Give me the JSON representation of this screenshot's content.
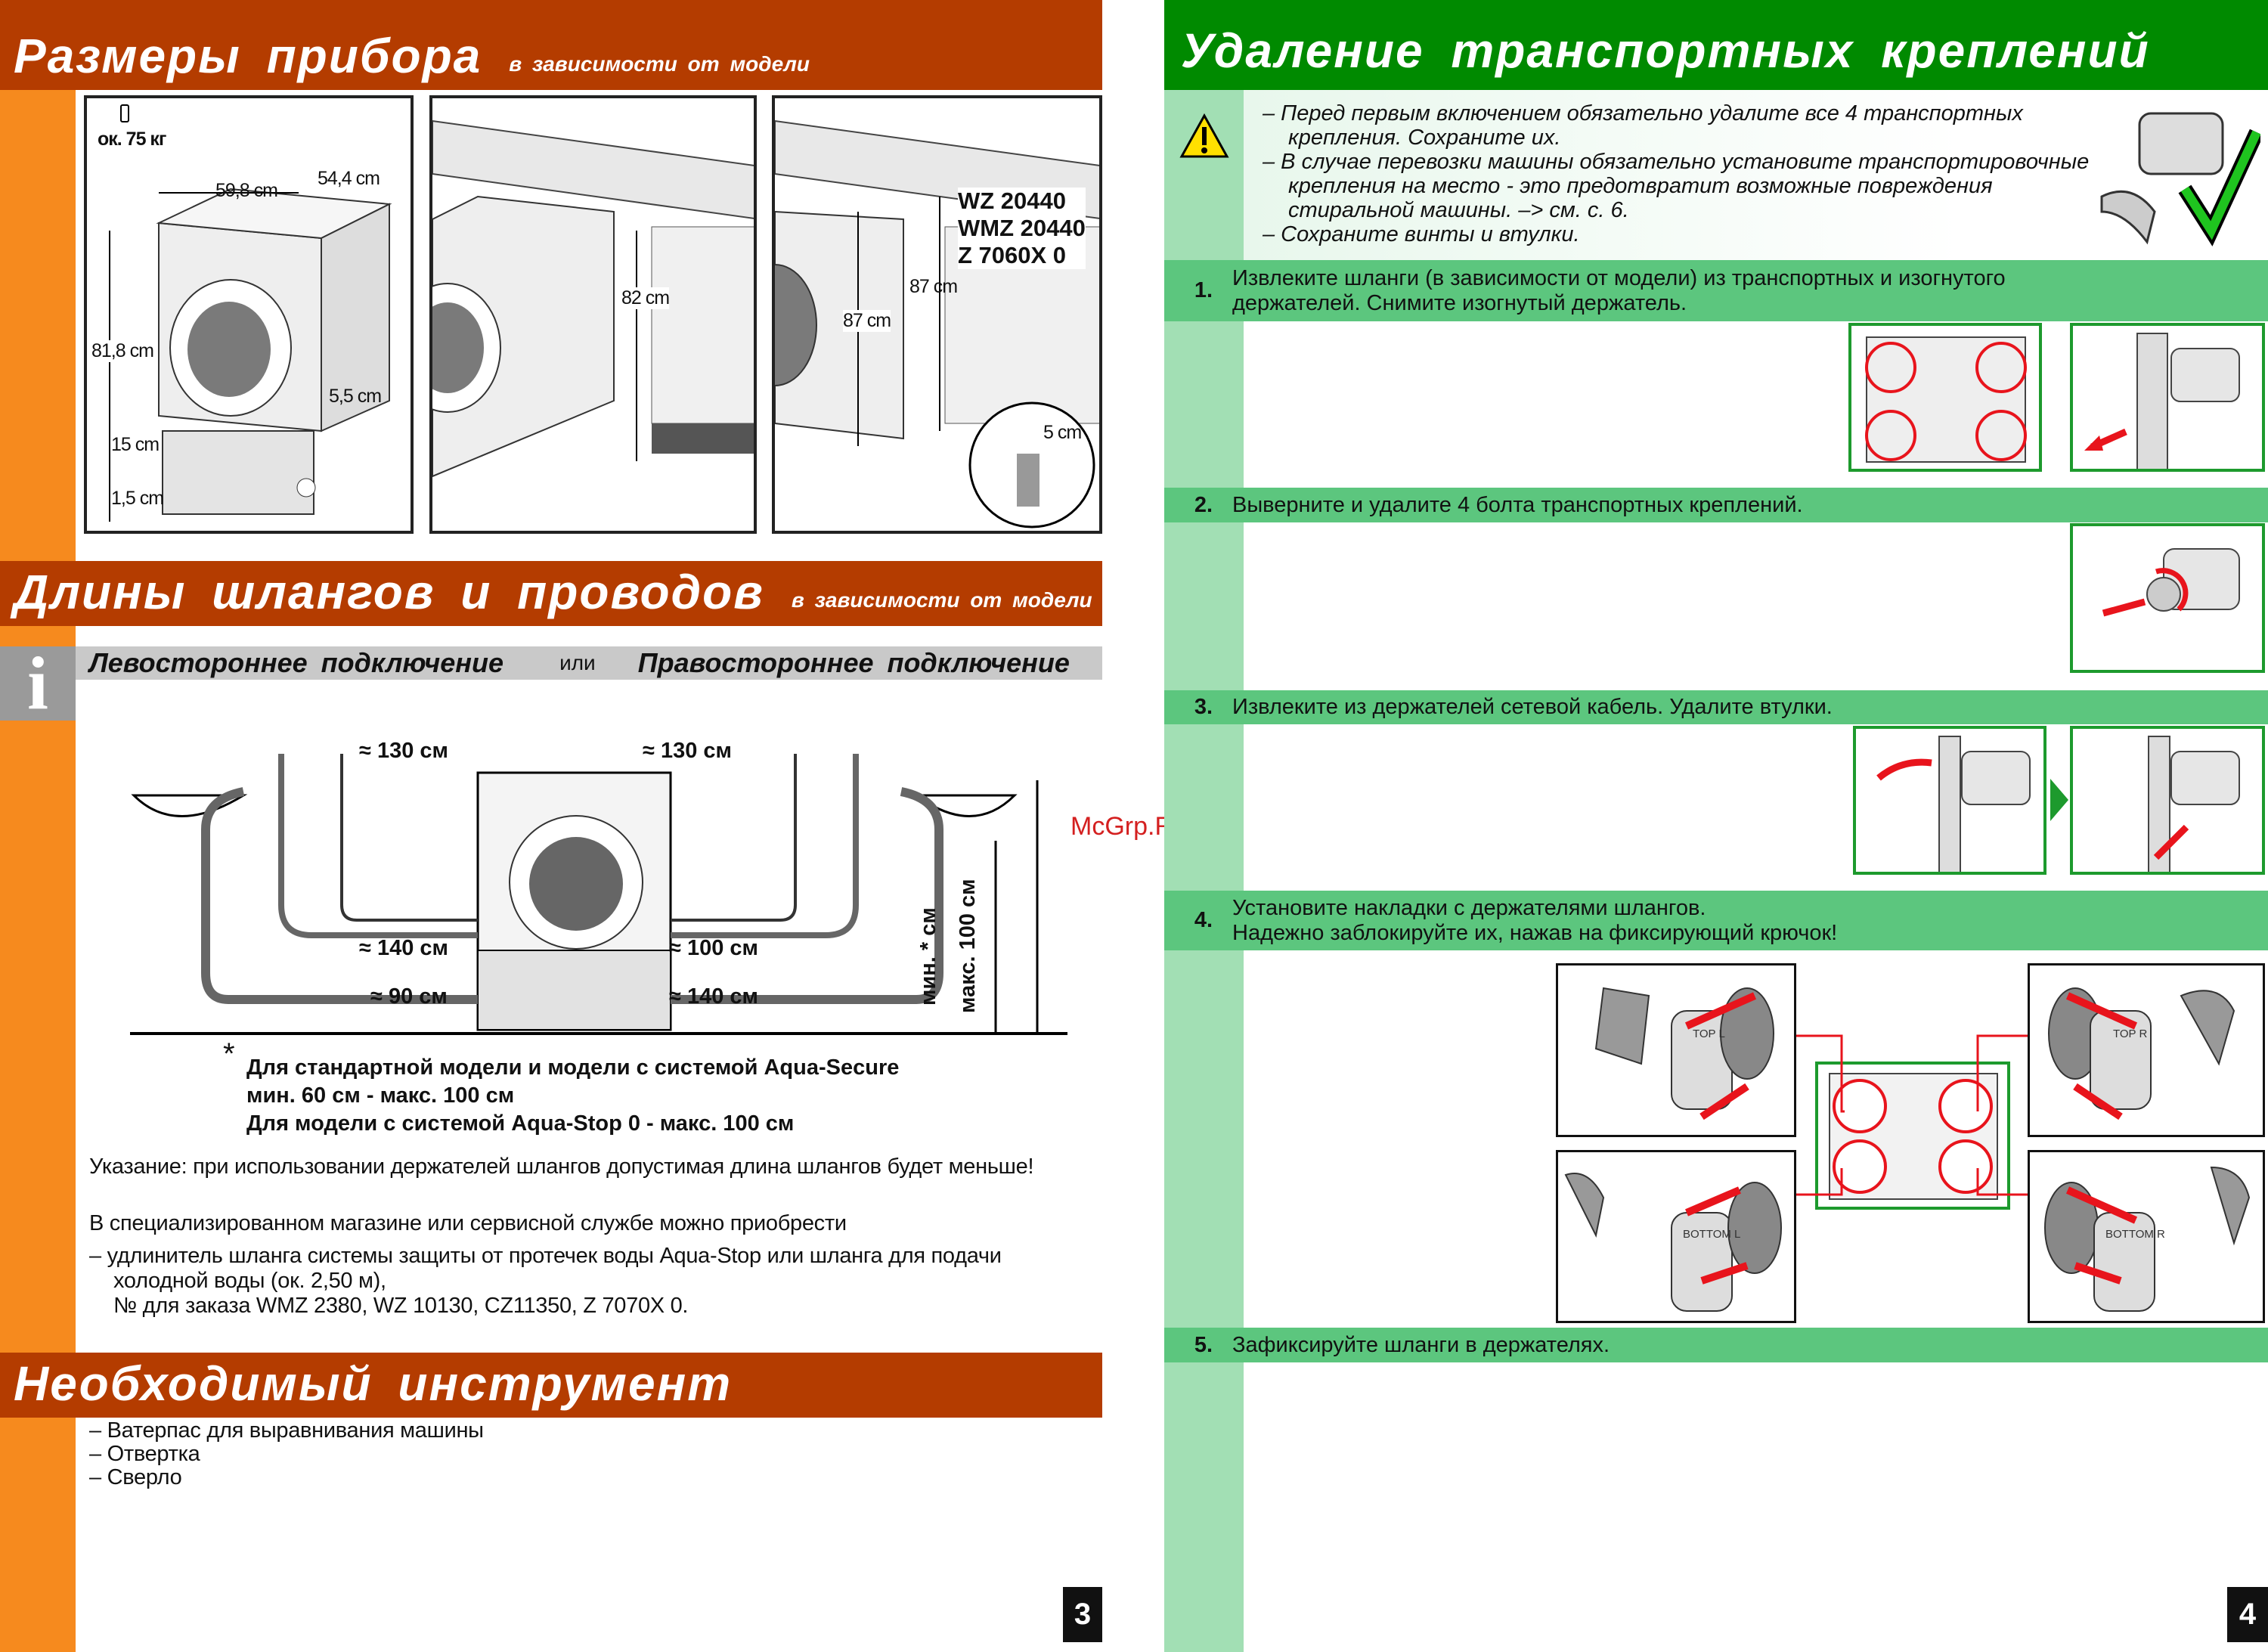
{
  "left_page": {
    "dimensions": {
      "title": "Размеры прибора",
      "subtitle": "в зависимости от модели",
      "weight": "ок. 75 кг",
      "width": "59,8 cm",
      "depth": "54,4 cm",
      "height": "81,8 cm",
      "offset": "5,5 cm",
      "base": "15 cm",
      "foot": "1,5 cm",
      "niche_height_1": "82 cm",
      "niche_height_2": "87 cm",
      "niche_height_3": "87 cm",
      "raise": "5 cm",
      "models": [
        "WZ 20440",
        "WMZ 20440",
        "Z 7060X 0"
      ]
    },
    "hoses": {
      "title": "Длины шлангов и проводов",
      "subtitle": "в зависимости от модели",
      "info_icon": "i",
      "left_label": "Левостороннее подключение",
      "or_label": "или",
      "right_label": "Правостороннее подключение",
      "lengths": {
        "left_cable": "≈ 130 см",
        "right_cable": "≈ 130 см",
        "left_inlet": "≈ 140 см",
        "left_drain": "≈ 90 см",
        "right_inlet": "≈ 100 см",
        "right_drain": "≈ 140 см",
        "min": "мин. * см",
        "max": "макс. 100 см"
      },
      "asterisk": "*",
      "footnote": [
        "Для стандартной модели и модели с системой Aqua-Secure",
        "мин. 60 см - макс. 100 см",
        "Для модели с системой Aqua-Stop 0 - макс. 100 см"
      ],
      "note": "Указание: при использовании держателей шлангов допустимая длина шлангов будет меньше!",
      "shop": "В специализированном магазине или сервисной службе можно приобрести",
      "item": "– удлинитель шланга системы защиты от протечек воды Aqua-Stop или шланга для подачи холодной воды (ок. 2,50 м),",
      "order": "№ для заказа WMZ 2380, WZ 10130, CZ11350, Z 7070X 0."
    },
    "tools": {
      "title": "Необходимый инструмент",
      "items": [
        "– Ватерпас для выравнивания машины",
        "– Отвертка",
        "– Сверло"
      ]
    },
    "page_number": "3"
  },
  "right_page": {
    "title": "Удаление транспортных креплений",
    "warning_icon": "warning-triangle",
    "warnings": [
      "– Перед первым включением обязательно удалите все 4 транспортных крепления. Сохраните их.",
      "– В случае перевозки машины обязательно установите транспортировочные крепления на место - это предотвратит возможные повреждения стиральной машины. –> см. с. 6.",
      "– Сохраните винты и втулки."
    ],
    "steps": [
      {
        "n": "1.",
        "text": "Извлеките шланги (в зависимости от модели) из транспортных и изогнутого держателей. Снимите изогнутый держатель."
      },
      {
        "n": "2.",
        "text": "Выверните и удалите 4 болта транспортных креплений."
      },
      {
        "n": "3.",
        "text": "Извлеките из держателей сетевой кабель. Удалите втулки."
      },
      {
        "n": "4.",
        "text": "Установите накладки с держателями шлангов.",
        "text2": "Надежно заблокируйте их, нажав на фиксирующий крючок!"
      },
      {
        "n": "5.",
        "text": "Зафиксируйте шланги в держателях."
      }
    ],
    "labels": {
      "top_l": "TOP L",
      "top_r": "TOP R",
      "bottom_l": "BOTTOM L",
      "bottom_r": "BOTTOM R"
    },
    "page_number": "4"
  },
  "watermark": "McGrp.Ru",
  "colors": {
    "orange_header": "#b43c00",
    "orange_strip": "#f68a1e",
    "green_header": "#008a00",
    "green_step": "#5cc67e",
    "green_strip": "#a2dfb4",
    "red_accent": "#e8141c"
  }
}
